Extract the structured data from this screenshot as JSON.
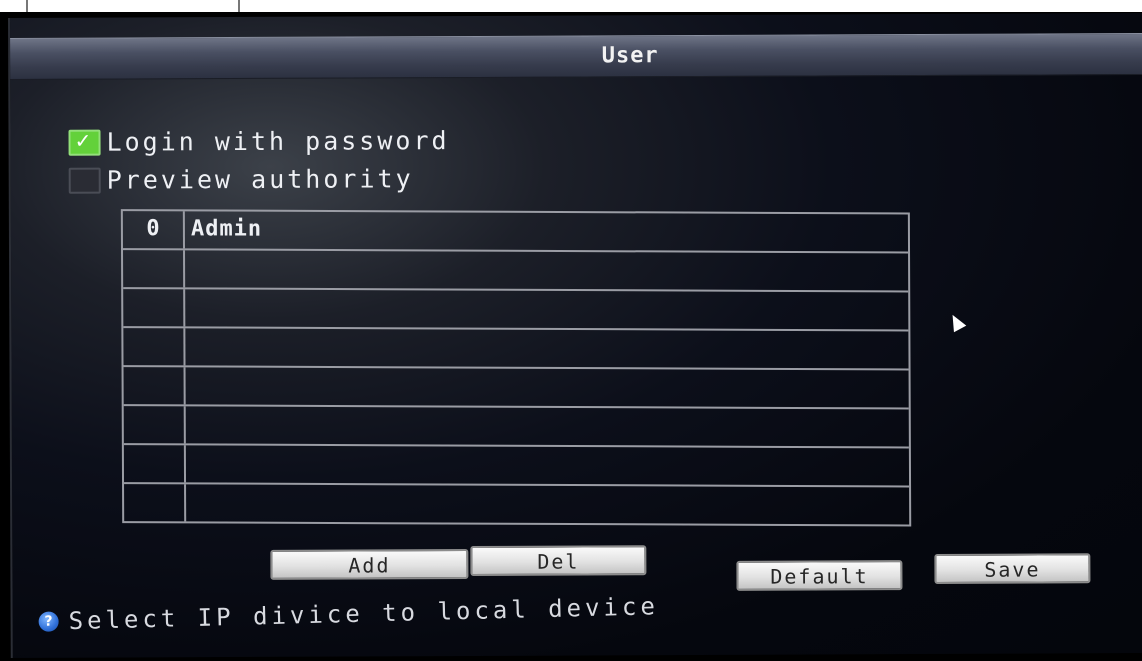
{
  "window": {
    "title": "User"
  },
  "options": {
    "login_with_password": {
      "label": "Login with password",
      "checked": true
    },
    "preview_authority": {
      "label": "Preview authority",
      "checked": false
    }
  },
  "users_table": {
    "rows": [
      {
        "index": "0",
        "name": "Admin"
      },
      {
        "index": "",
        "name": ""
      },
      {
        "index": "",
        "name": ""
      },
      {
        "index": "",
        "name": ""
      },
      {
        "index": "",
        "name": ""
      },
      {
        "index": "",
        "name": ""
      },
      {
        "index": "",
        "name": ""
      },
      {
        "index": "",
        "name": ""
      }
    ]
  },
  "buttons": {
    "add": "Add",
    "del": "Del",
    "default": "Default",
    "save": "Save"
  },
  "status": {
    "help_text": "Select IP divice to local device"
  },
  "icons": {
    "close": "close-icon",
    "help": "help-icon",
    "checkbox_checked": "check-mark-icon",
    "cursor": "mouse-cursor-icon"
  },
  "colors": {
    "checked_accent": "#63d13a",
    "help_icon": "#2f6fd8"
  }
}
